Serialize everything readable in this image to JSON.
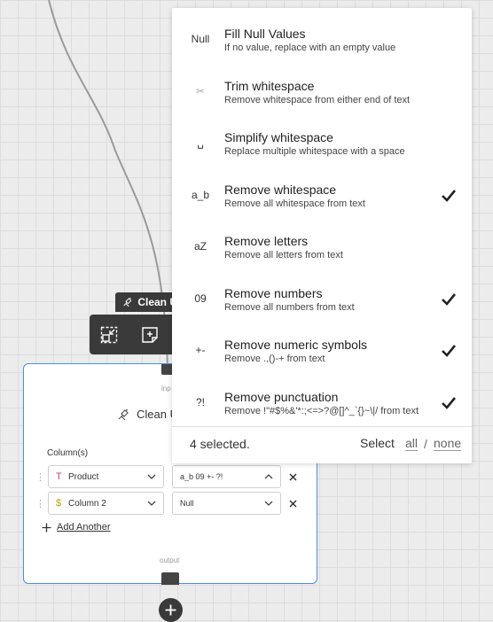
{
  "node": {
    "tag_label": "Clean U",
    "title": "Clean U",
    "input_label": "inp",
    "output_label": "output",
    "columns_label": "Column(s)",
    "add_another": "Add Another",
    "rows": [
      {
        "type_icon": "T",
        "type_color": "#d63c7a",
        "column": "Product",
        "operations": "a_b  09  +-  ?!",
        "caret": "up"
      },
      {
        "type_icon": "$",
        "type_color": "#c79a00",
        "column": "Column 2",
        "operations": "Null",
        "caret": "down"
      }
    ]
  },
  "panel": {
    "options": [
      {
        "icon": "Null",
        "title": "Fill Null Values",
        "desc": "If no value, replace with an empty value",
        "checked": false
      },
      {
        "icon": "scissors-icon",
        "title": "Trim whitespace",
        "desc": "Remove whitespace from either end of text",
        "checked": false
      },
      {
        "icon": "␣",
        "title": "Simplify whitespace",
        "desc": "Replace multiple whitespace with a space",
        "checked": false
      },
      {
        "icon": "a_b",
        "title": "Remove whitespace",
        "desc": "Remove all whitespace from text",
        "checked": true
      },
      {
        "icon": "aZ",
        "title": "Remove letters",
        "desc": "Remove all letters from text",
        "checked": false
      },
      {
        "icon": "09",
        "title": "Remove numbers",
        "desc": "Remove all numbers from text",
        "checked": true
      },
      {
        "icon": "+-",
        "title": "Remove numeric symbols",
        "desc": "Remove .,()-+ from text",
        "checked": true
      },
      {
        "icon": "?!",
        "title": "Remove punctuation",
        "desc": "Remove !\"#$%&'*:;<=>?@[]^_`{}~\\|/ from text",
        "checked": true
      }
    ],
    "footer": {
      "count_text": "4 selected.",
      "select_label": "Select",
      "all": "all",
      "slash": "/",
      "none": "none"
    }
  },
  "colors": {
    "accent": "#4a8ee0",
    "toolbar_bg": "#3a3a3a",
    "canvas_bg": "#ececec"
  }
}
